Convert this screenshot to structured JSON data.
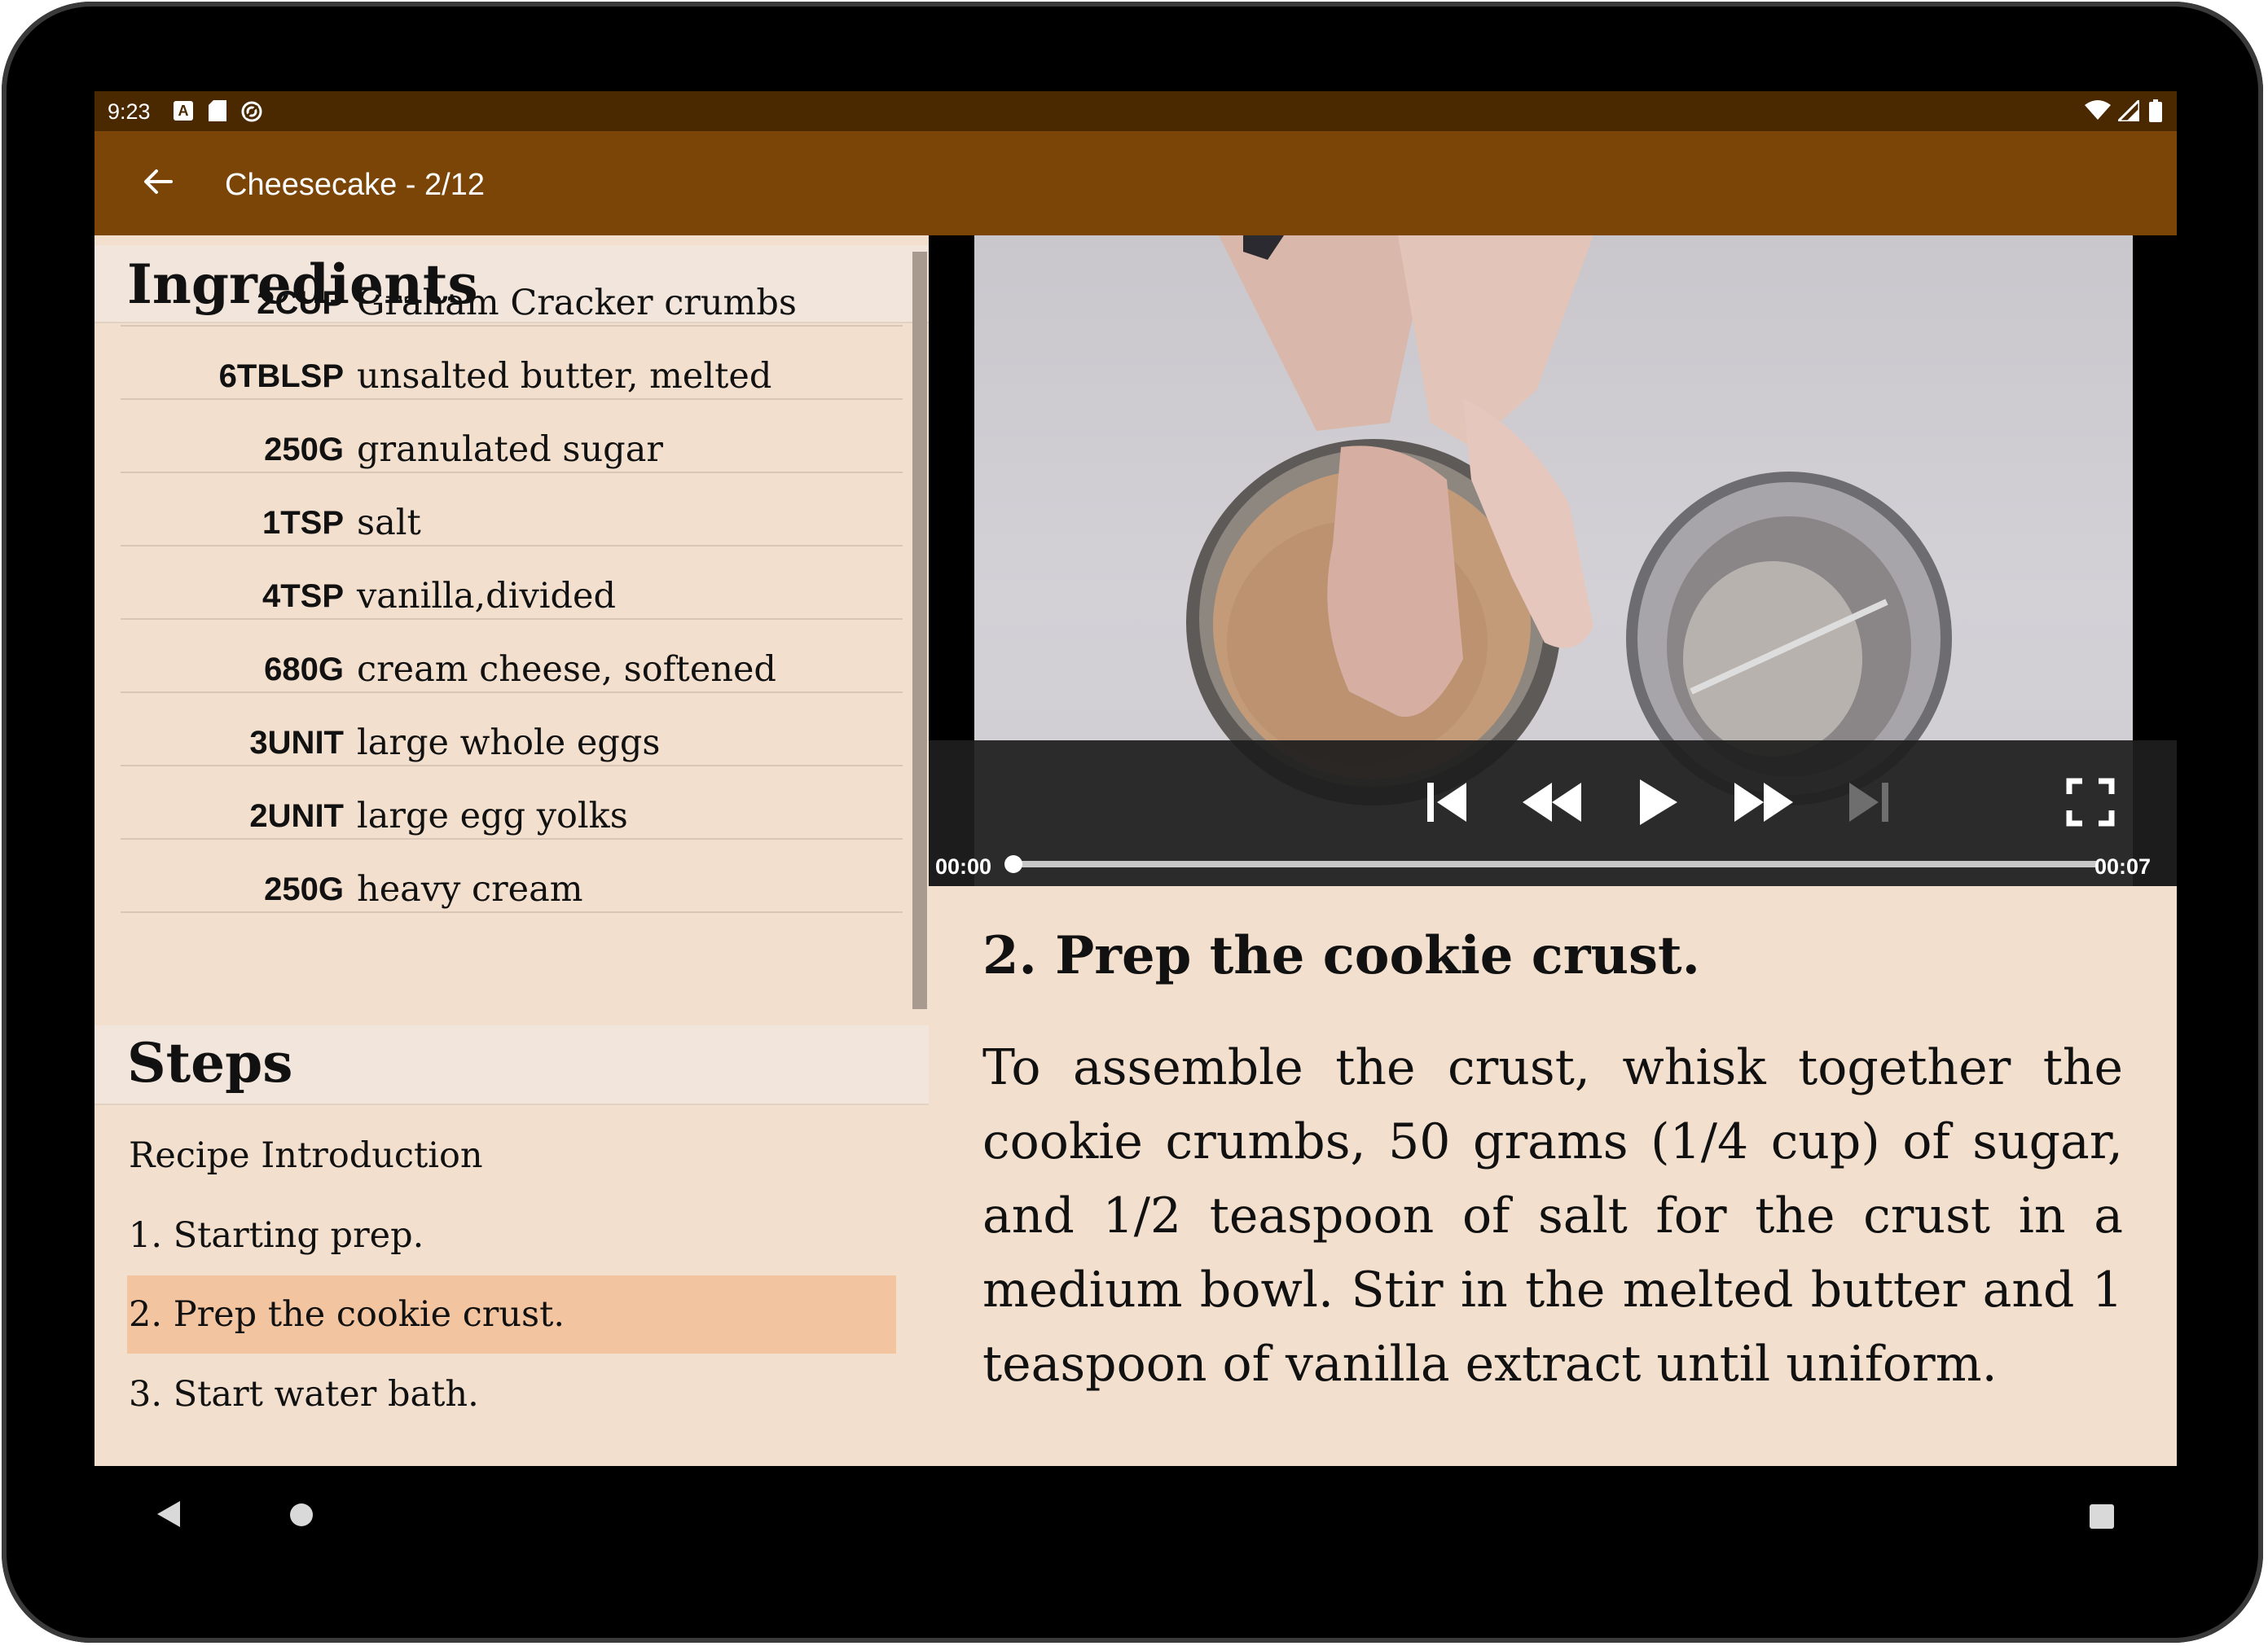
{
  "status_bar": {
    "time": "9:23",
    "left_icons": [
      "a-notification-icon",
      "sd-card-icon",
      "sync-icon"
    ],
    "right_icons": [
      "wifi-icon",
      "cell-signal-icon",
      "battery-icon"
    ]
  },
  "app_bar": {
    "title": "Cheesecake - 2/12",
    "back_icon": "arrow-back-icon"
  },
  "ingredients": {
    "heading": "Ingredients",
    "items": [
      {
        "qty": "2CUP",
        "name": "Graham Cracker crumbs"
      },
      {
        "qty": "6TBLSP",
        "name": "unsalted butter, melted"
      },
      {
        "qty": "250G",
        "name": "granulated sugar"
      },
      {
        "qty": "1TSP",
        "name": "salt"
      },
      {
        "qty": "4TSP",
        "name": "vanilla,divided"
      },
      {
        "qty": "680G",
        "name": "cream cheese, softened"
      },
      {
        "qty": "3UNIT",
        "name": "large whole eggs"
      },
      {
        "qty": "2UNIT",
        "name": "large egg yolks"
      },
      {
        "qty": "250G",
        "name": "heavy cream"
      }
    ]
  },
  "steps": {
    "heading": "Steps",
    "items": [
      {
        "label": "Recipe Introduction",
        "selected": false
      },
      {
        "label": "1. Starting prep.",
        "selected": false
      },
      {
        "label": "2. Prep the cookie crust.",
        "selected": true
      },
      {
        "label": "3. Start water bath.",
        "selected": false
      }
    ]
  },
  "player": {
    "position": "00:00",
    "duration": "00:07",
    "progress_fraction": 0.0,
    "controls": [
      "skip-previous-icon",
      "rewind-icon",
      "play-icon",
      "fast-forward-icon",
      "skip-next-icon",
      "fullscreen-icon"
    ]
  },
  "step_detail": {
    "title": "2. Prep the cookie crust.",
    "body": "To assemble the crust, whisk together the cookie crumbs, 50 grams (1/4 cup) of sugar, and 1/2 teaspoon of salt for the crust in a medium bowl. Stir in the melted butter and 1 teaspoon of vanilla extract until uniform."
  },
  "nav_bar": {
    "icons": [
      "nav-back-icon",
      "nav-home-icon",
      "nav-recents-icon"
    ]
  },
  "colors": {
    "status_bar": "#4a2800",
    "app_bar": "#7b4508",
    "background": "#f2dfcd",
    "selected_step": "#f2c4a0"
  }
}
